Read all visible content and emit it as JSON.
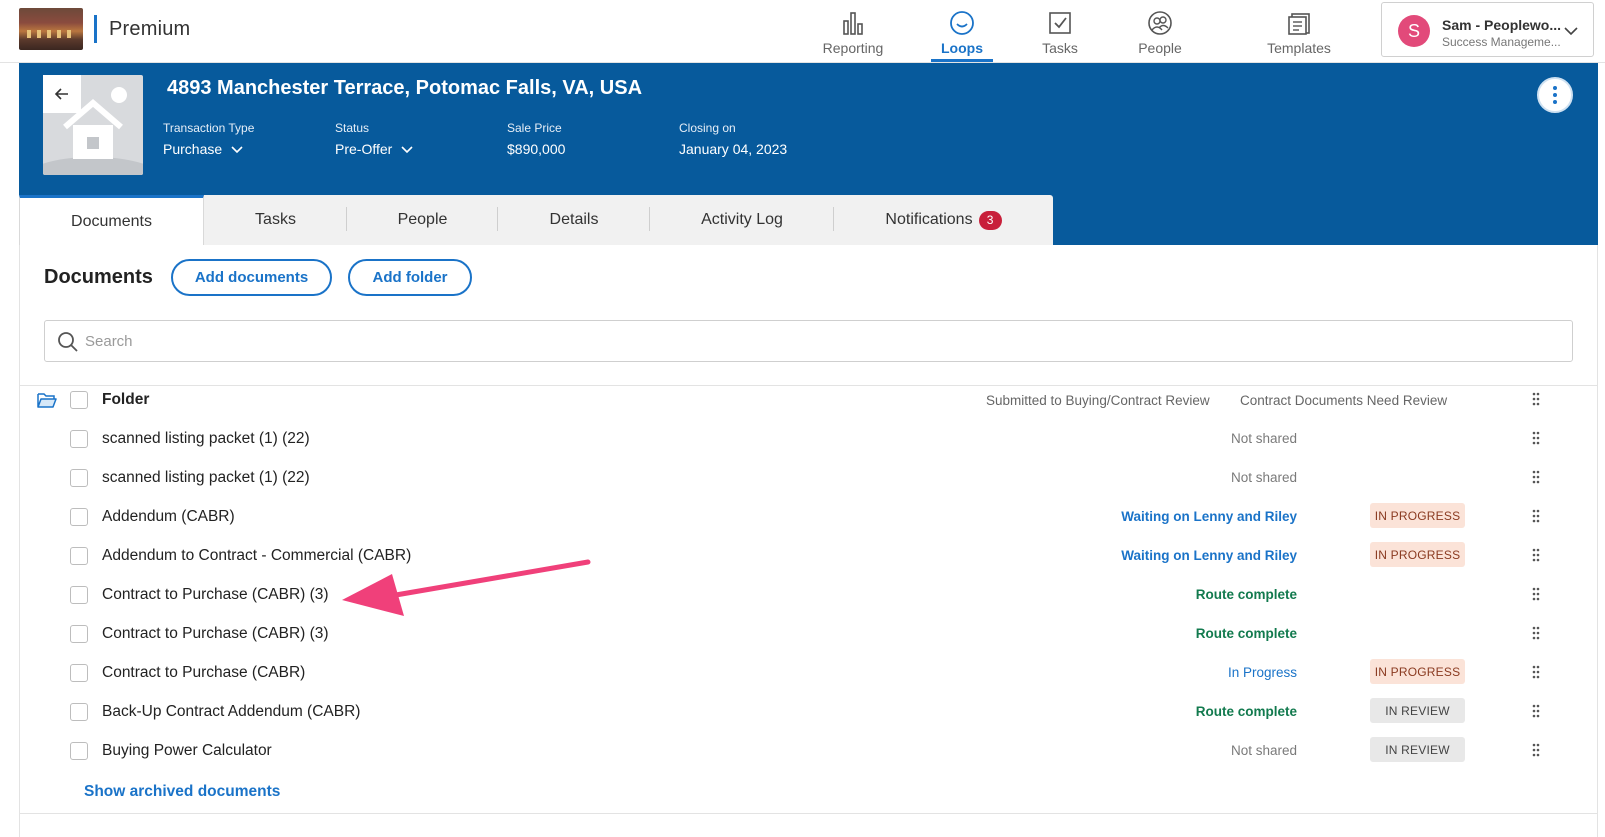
{
  "app": {
    "brand": "Premium"
  },
  "nav": [
    {
      "label": "Reporting",
      "icon": "bar-chart-icon"
    },
    {
      "label": "Loops",
      "icon": "smile-circle-icon",
      "active": true
    },
    {
      "label": "Tasks",
      "icon": "checkbox-icon"
    },
    {
      "label": "People",
      "icon": "people-icon"
    },
    {
      "label": "Templates",
      "icon": "templates-icon"
    }
  ],
  "user": {
    "initial": "S",
    "name": "Sam - Peoplewo...",
    "subtitle": "Success Manageme..."
  },
  "property": {
    "address": "4893 Manchester Terrace, Potomac Falls, VA, USA",
    "transaction_type_label": "Transaction Type",
    "transaction_type": "Purchase",
    "status_label": "Status",
    "status": "Pre-Offer",
    "sale_price_label": "Sale Price",
    "sale_price": "$890,000",
    "closing_label": "Closing on",
    "closing_date": "January 04, 2023"
  },
  "tabs": [
    {
      "label": "Documents",
      "active": true
    },
    {
      "label": "Tasks"
    },
    {
      "label": "People"
    },
    {
      "label": "Details"
    },
    {
      "label": "Activity Log"
    },
    {
      "label": "Notifications",
      "badge": "3"
    }
  ],
  "documents": {
    "title": "Documents",
    "add_documents": "Add documents",
    "add_folder": "Add folder",
    "search_placeholder": "Search",
    "folder": {
      "name": "Folder",
      "col1": "Submitted to Buying/Contract Review",
      "col2": "Contract Documents Need Review"
    },
    "rows": [
      {
        "name": "scanned listing packet (1) (22)",
        "status": "Not shared",
        "status_kind": "gray",
        "pill": ""
      },
      {
        "name": "scanned listing packet (1) (22)",
        "status": "Not shared",
        "status_kind": "gray",
        "pill": ""
      },
      {
        "name": "Addendum (CABR)",
        "status": "Waiting on Lenny and Riley",
        "status_kind": "wait",
        "pill": "IN PROGRESS",
        "pill_kind": "prog"
      },
      {
        "name": "Addendum to Contract - Commercial (CABR)",
        "status": "Waiting on Lenny and Riley",
        "status_kind": "wait",
        "pill": "IN PROGRESS",
        "pill_kind": "prog"
      },
      {
        "name": "Contract to Purchase (CABR) (3)",
        "status": "Route complete",
        "status_kind": "green",
        "pill": ""
      },
      {
        "name": "Contract to Purchase (CABR) (3)",
        "status": "Route complete",
        "status_kind": "green",
        "pill": ""
      },
      {
        "name": "Contract to Purchase (CABR)",
        "status": "In Progress",
        "status_kind": "blue",
        "pill": "IN PROGRESS",
        "pill_kind": "prog"
      },
      {
        "name": "Back-Up Contract Addendum (CABR)",
        "status": "Route complete",
        "status_kind": "green",
        "pill": "IN REVIEW",
        "pill_kind": "rev"
      },
      {
        "name": "Buying Power Calculator",
        "status": "Not shared",
        "status_kind": "gray",
        "pill": "IN REVIEW",
        "pill_kind": "rev"
      }
    ],
    "show_archived": "Show archived documents"
  },
  "colors": {
    "brand_blue": "#075a9c",
    "link_blue": "#1a73c8",
    "badge_red": "#c81f3a",
    "arrow_pink": "#f0407a"
  }
}
